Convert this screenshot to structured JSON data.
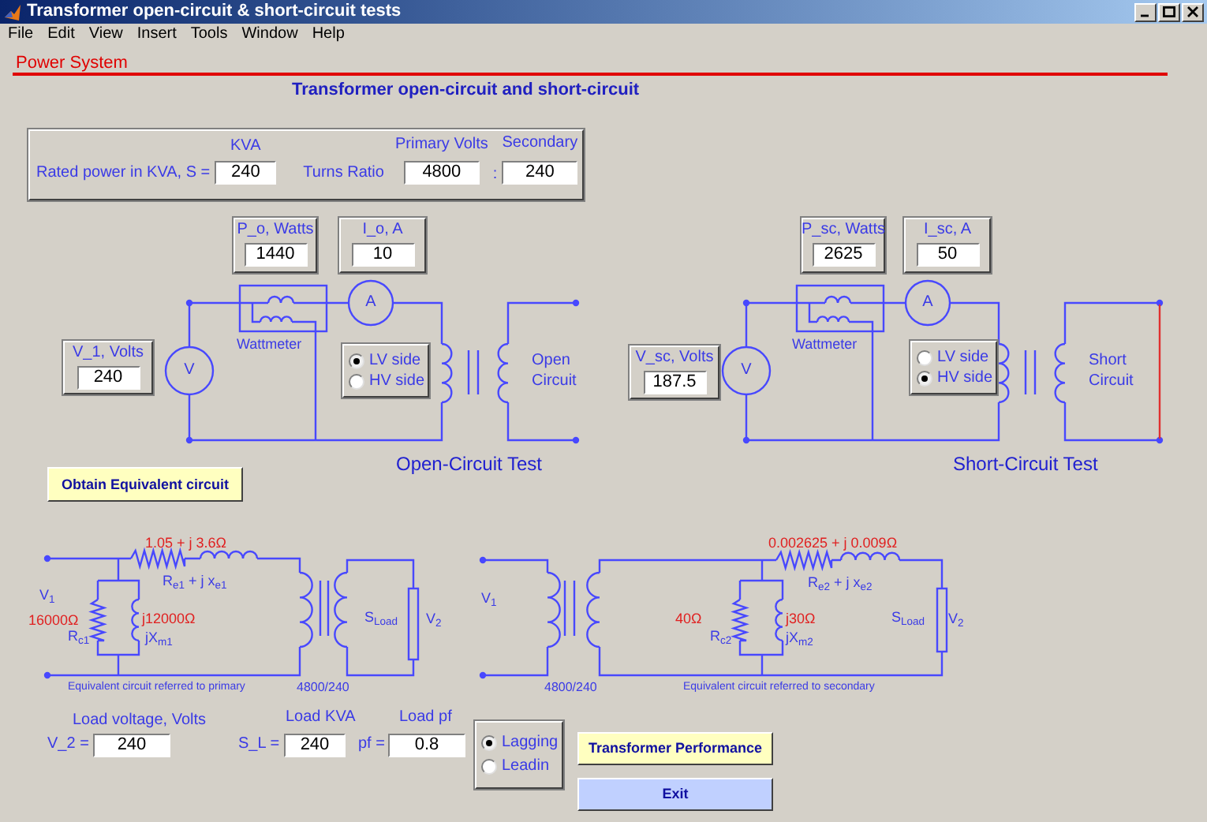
{
  "window": {
    "title": "Transformer open-circuit & short-circuit tests"
  },
  "menu": [
    "File",
    "Edit",
    "View",
    "Insert",
    "Tools",
    "Window",
    "Help"
  ],
  "header": {
    "section": "Power System",
    "title": "Transformer open-circuit and short-circuit"
  },
  "ratings": {
    "rated_label": "Rated power in KVA, S =",
    "kva_label": "KVA",
    "kva_value": "240",
    "turns_label": "Turns Ratio",
    "primary_label": "Primary Volts",
    "primary_value": "4800",
    "separator": ":",
    "secondary_label": "Secondary",
    "secondary_value": "240"
  },
  "tests": [
    {
      "title": "Open-Circuit Test",
      "power": {
        "label": "P_o, Watts",
        "value": "1440"
      },
      "current": {
        "label": "I_o, A",
        "value": "10"
      },
      "voltage": {
        "label": "V_1, Volts",
        "value": "240"
      },
      "voltmeter": "V",
      "ammeter": "A",
      "wattmeter": "Wattmeter",
      "sides": [
        {
          "label": "LV side",
          "selected": true
        },
        {
          "label": "HV side",
          "selected": false
        }
      ],
      "secondary": [
        "Open",
        "Circuit"
      ],
      "shorted": false
    },
    {
      "title": "Short-Circuit Test",
      "power": {
        "label": "P_sc, Watts",
        "value": "2625"
      },
      "current": {
        "label": "I_sc, A",
        "value": "50"
      },
      "voltage": {
        "label": "V_sc, Volts",
        "value": "187.5"
      },
      "voltmeter": "V",
      "ammeter": "A",
      "wattmeter": "Wattmeter",
      "sides": [
        {
          "label": "LV side",
          "selected": false
        },
        {
          "label": "HV side",
          "selected": true
        }
      ],
      "secondary": [
        "Short",
        "Circuit"
      ],
      "shorted": true
    }
  ],
  "equivalent_button": "Obtain Equivalent circuit",
  "equivalent_circuits": [
    {
      "series_value": "1.05 + j 3.6Ω",
      "series_label": "R$_{e1}$ + j x$_{e1}$",
      "v1": "V$_{1}$",
      "rc_value": "16000Ω",
      "rc_label": "R$_{c1}$",
      "xm_value": "j12000Ω",
      "xm_label": "jX$_{m1}$",
      "load": "S$_{Load}$",
      "v2": "V$_{2}$",
      "caption": "Equivalent circuit referred to primary",
      "ratio": "4800/240"
    },
    {
      "series_value": "0.002625 + j 0.009Ω",
      "series_label": "R$_{e2}$ + j x$_{e2}$",
      "v1": "V$_{1}$",
      "rc_value": "40Ω",
      "rc_label": "R$_{c2}$",
      "xm_value": "j30Ω",
      "xm_label": "jX$_{m2}$",
      "load": "S$_{Load}$",
      "v2": "V$_{2}$",
      "caption": "Equivalent circuit referred to secondary",
      "ratio": "4800/240"
    }
  ],
  "load": {
    "voltage_label": "Load voltage, Volts",
    "voltage_prefix": "V_2 =",
    "voltage_value": "240",
    "kva_label": "Load KVA",
    "kva_prefix": "S_L =",
    "kva_value": "240",
    "pf_label": "Load pf",
    "pf_prefix": "pf =",
    "pf_value": "0.8"
  },
  "pf_modes": [
    {
      "label": "Lagging",
      "selected": true
    },
    {
      "label": "Leadin",
      "selected": false
    }
  ],
  "buttons": [
    {
      "label": "Transformer Performance",
      "kind": "performance"
    },
    {
      "label": "Exit",
      "kind": "exit"
    }
  ]
}
